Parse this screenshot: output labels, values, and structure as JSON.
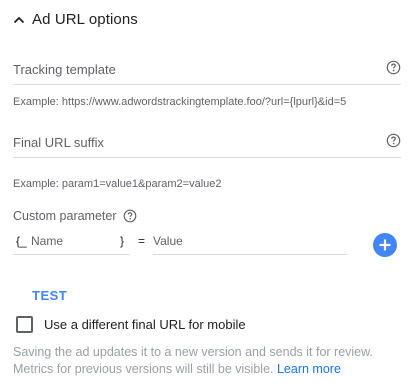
{
  "section": {
    "title": "Ad URL options"
  },
  "tracking_template": {
    "placeholder": "Tracking template",
    "example": "Example: https://www.adwordstrackingtemplate.foo/?url={lpurl}&id=5"
  },
  "final_url_suffix": {
    "placeholder": "Final URL suffix",
    "example": "Example: param1=value1&param2=value2"
  },
  "custom_parameter": {
    "label": "Custom parameter",
    "brace_open": "{_",
    "name_placeholder": "Name",
    "brace_close": "}",
    "equals": "=",
    "value_placeholder": "Value"
  },
  "test_label": "TEST",
  "mobile_checkbox": {
    "label": "Use a different final URL for mobile",
    "checked": false
  },
  "note": {
    "line1": "Saving the ad updates it to a new version and sends it for review.",
    "line2": "Metrics for previous versions will still be visible.",
    "link": "Learn more"
  },
  "colors": {
    "accent": "#4285f4",
    "link": "#1a73e8",
    "text": "#202124",
    "muted": "#5f6368"
  }
}
